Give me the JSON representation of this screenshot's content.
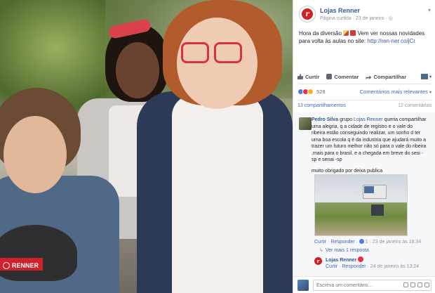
{
  "photo": {
    "brand_badge": "RENNER"
  },
  "post": {
    "page_name": "Lojas Renner",
    "meta_visibility": "Página curtida",
    "meta_date": "23 de janeiro",
    "text_line1": "Hora da diversão",
    "text_line1b": "Vem ver nossas novidades",
    "text_line2": "para volta às aulas no site:",
    "link": "http://ren-ner.co/jCr"
  },
  "actions": {
    "like": "Curtir",
    "comment": "Comentar",
    "share": "Compartilhar"
  },
  "reactions": {
    "count": "528",
    "sort_label": "Comentários mais relevantes"
  },
  "stats": {
    "shares": "13 compartilhamentos",
    "comments": "12 comentários"
  },
  "comment1": {
    "author": "Pedro Silva",
    "text_a": "grupo",
    "mention": "Lojas Renner",
    "text_b": "queria compartilhar uma alegria, q a cidade de registro e o vale do ribeira estão conseguindo realizar, um sonho d ter uma boa escola q é da industria que ajudará muito a trazer um futuro melhor não só para o vale do ribeira ,mais para o brasil. e a chegada em breve do sesi -sp e senai -sp",
    "text_c": "muito obrigado por deixa publica",
    "meta_like": "Curtir",
    "meta_reply": "Responder",
    "meta_likes": "1",
    "meta_date": "23 de janeiro às 18:34",
    "more_replies": "Ver mais 1 resposta"
  },
  "reply1": {
    "author": "Lojas Renner",
    "meta_like": "Curtir",
    "meta_reply": "Responder",
    "meta_date": "24 de janeiro às 13:24"
  },
  "composer": {
    "placeholder": "Escreva um comentário..."
  }
}
